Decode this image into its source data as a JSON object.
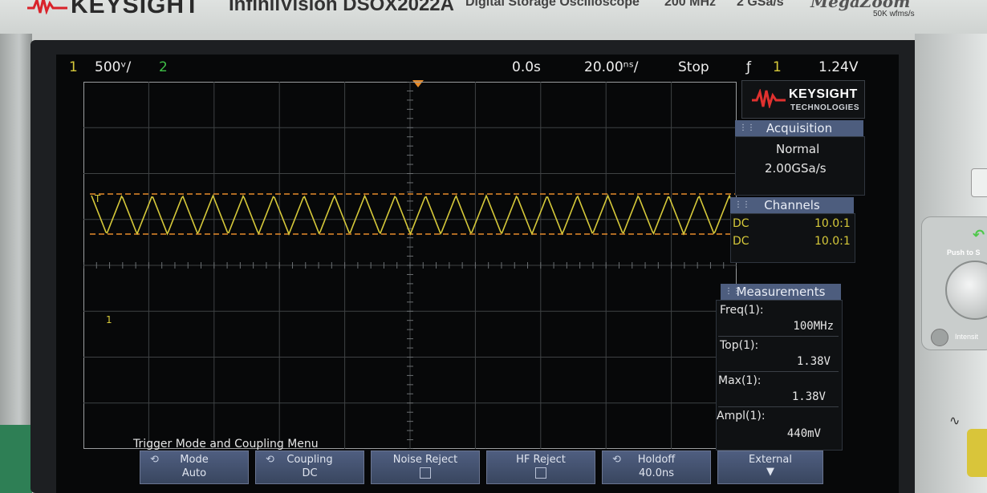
{
  "instrument": {
    "brand": "KEYSIGHT",
    "model": "InfiniiVision DSOX2022A",
    "subtitle": "Digital Storage Oscilloscope",
    "bandwidth": "200 MHz",
    "sample_rate": "2 GSa/s",
    "megazoom": "MegaZoom",
    "wfms": "50K wfms/s",
    "push_label": "Push to S",
    "intensity_label": "Intensit"
  },
  "status_bar": {
    "ch1_label": "1",
    "ch1_scale": "500ᵛ/",
    "ch2_label": "2",
    "time_delay": "0.0s",
    "time_scale": "20.00ⁿˢ/",
    "run_state": "Stop",
    "trigger_icon": "ƒ",
    "trigger_source": "1",
    "trigger_level": "1.24V"
  },
  "side_panel": {
    "logo_main": "KEYSIGHT",
    "logo_sub": "TECHNOLOGIES",
    "acquisition": {
      "title": "Acquisition",
      "mode": "Normal",
      "rate": "2.00GSa/s"
    },
    "channels": {
      "title": "Channels",
      "rows": [
        {
          "coupling": "DC",
          "probe": "10.0:1"
        },
        {
          "coupling": "DC",
          "probe": "10.0:1"
        }
      ]
    },
    "measurements": {
      "title": "Measurements",
      "items": [
        {
          "label": "Freq(1):",
          "value": "100MHz"
        },
        {
          "label": "Top(1):",
          "value": "1.38V"
        },
        {
          "label": "Max(1):",
          "value": "1.38V"
        },
        {
          "label": "Ampl(1):",
          "value": "440mV"
        }
      ]
    }
  },
  "menu": {
    "title": "Trigger Mode and Coupling Menu",
    "softkeys": [
      {
        "label": "Mode",
        "value": "Auto"
      },
      {
        "label": "Coupling",
        "value": "DC"
      },
      {
        "label": "Noise Reject",
        "value": ""
      },
      {
        "label": "HF Reject",
        "value": ""
      },
      {
        "label": "Holdoff",
        "value": "40.0ns"
      },
      {
        "label": "External",
        "value": ""
      }
    ]
  },
  "markers": {
    "ch1_ground": "1",
    "trigger_level_marker": "T"
  },
  "colors": {
    "ch1": "#d6c93a",
    "ch2": "#3fbf47",
    "trigger": "#e58a2a",
    "grid": "#4a4d50",
    "menu": "#4d5d7e"
  }
}
